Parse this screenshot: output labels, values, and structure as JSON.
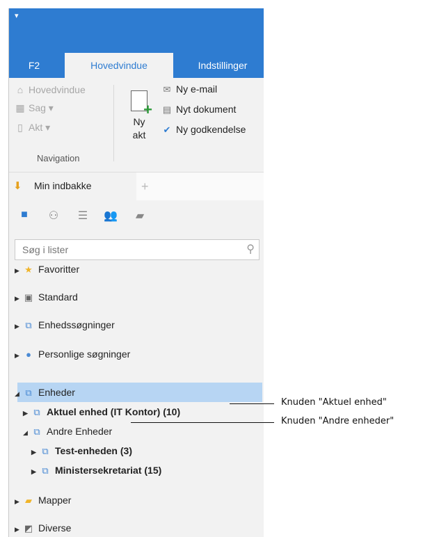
{
  "tabs": [
    "F2",
    "Hovedvindue",
    "Indstillinger"
  ],
  "navigation": {
    "items": [
      {
        "label": "Hovedvindue",
        "icon": "home-icon"
      },
      {
        "label": "Sag ▾",
        "icon": "case-icon"
      },
      {
        "label": "Akt ▾",
        "icon": "document-icon"
      }
    ],
    "group_label": "Navigation"
  },
  "new_act": {
    "label_line1": "Ny",
    "label_line2": "akt"
  },
  "ribbon_actions": [
    {
      "label": "Ny e-mail",
      "icon": "email-icon"
    },
    {
      "label": "Nyt dokument",
      "icon": "document-icon"
    },
    {
      "label": "Ny godkendelse",
      "icon": "approval-icon"
    }
  ],
  "inbox": {
    "label": "Min indbakke"
  },
  "search": {
    "placeholder": "Søg i lister"
  },
  "tree": [
    {
      "label": "Favoritter"
    },
    {
      "label": "Standard"
    },
    {
      "label": "Enhedssøgninger"
    },
    {
      "label": "Personlige søgninger"
    },
    {
      "label": "Enheder"
    },
    {
      "label": "Aktuel enhed (IT Kontor) (10)"
    },
    {
      "label": "Andre Enheder"
    },
    {
      "label": "Test-enheden (3)"
    },
    {
      "label": "Ministersekretariat (15)"
    },
    {
      "label": "Mapper"
    },
    {
      "label": "Diverse"
    }
  ],
  "callouts": [
    "Knuden \"Aktuel enhed\"",
    "Knuden \"Andre enheder\""
  ],
  "colors": {
    "accent": "#2e7cd1",
    "selection": "#b7d5f3",
    "add": "#2e9b3a"
  }
}
